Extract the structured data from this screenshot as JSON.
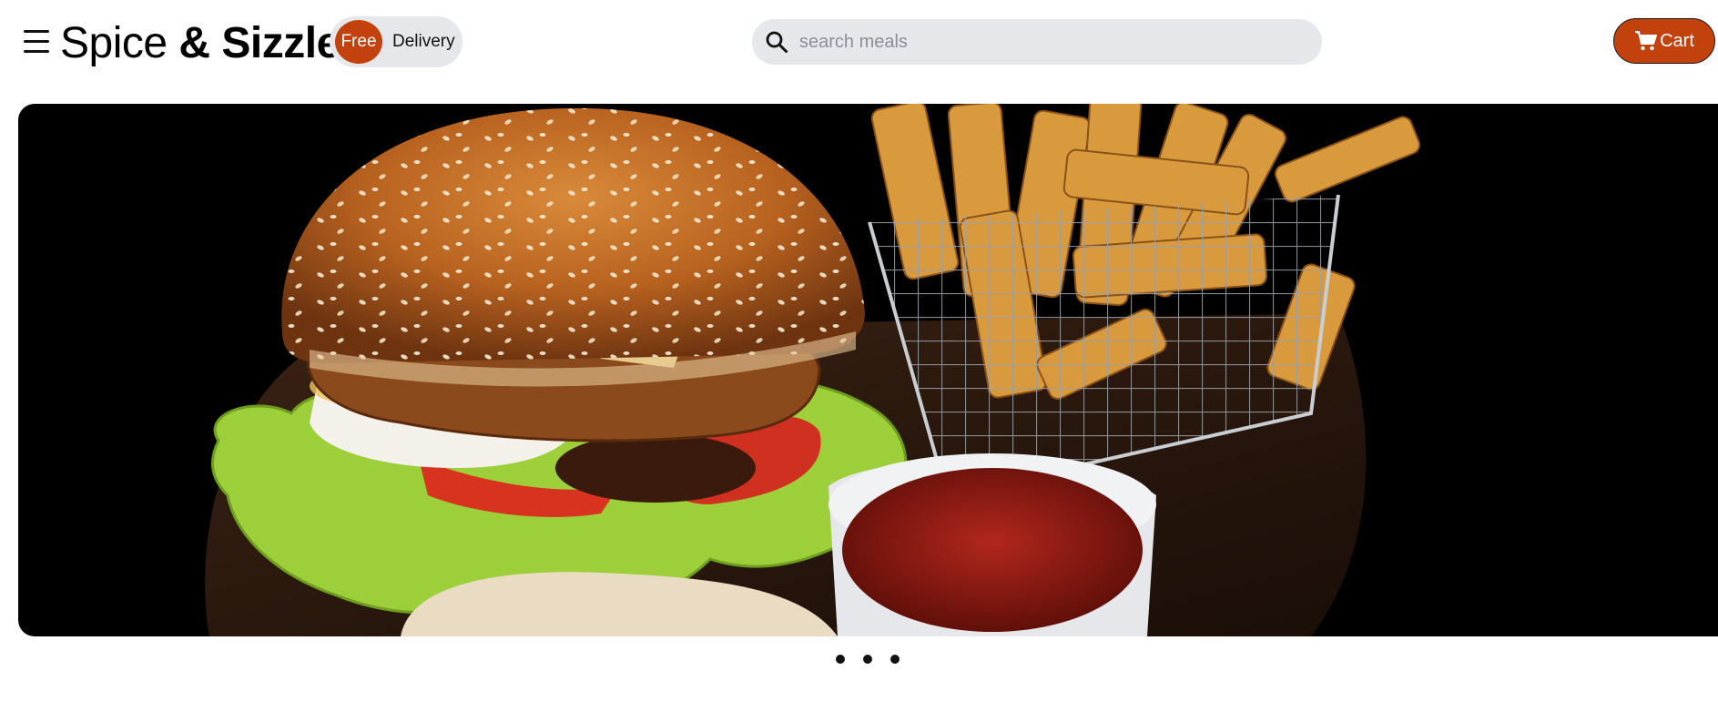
{
  "header": {
    "brand_light": "Spice ",
    "brand_bold": "& Sizzle",
    "badge_free": "Free",
    "badge_delivery": "Delivery",
    "search_placeholder": "search meals",
    "search_value": "",
    "cart_label": "Cart"
  },
  "hero": {
    "image_alt": "burger with fries and ketchup",
    "slides": 3
  },
  "colors": {
    "accent": "#c2410c",
    "pill_bg": "#e5e7eb",
    "hero_bg": "#000000"
  },
  "icons": [
    "menu-icon",
    "search-icon",
    "cart-icon"
  ]
}
